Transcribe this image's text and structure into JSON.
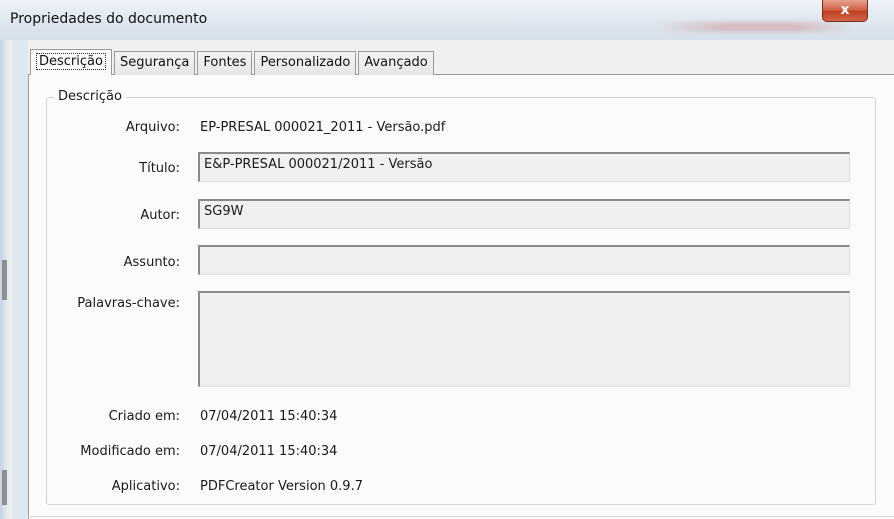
{
  "window": {
    "title": "Propriedades do documento",
    "close_symbol": "x"
  },
  "tabs": [
    {
      "label": "Descrição",
      "active": true
    },
    {
      "label": "Segurança"
    },
    {
      "label": "Fontes"
    },
    {
      "label": "Personalizado"
    },
    {
      "label": "Avançado"
    }
  ],
  "group": {
    "title": "Descrição"
  },
  "fields": {
    "arquivo": {
      "label": "Arquivo:",
      "value": "EP-PRESAL 000021_2011 - Versão.pdf"
    },
    "titulo": {
      "label": "Título:",
      "value": "E&P-PRESAL 000021/2011 - Versão"
    },
    "autor": {
      "label": "Autor:",
      "value": "SG9W"
    },
    "assunto": {
      "label": "Assunto:",
      "value": ""
    },
    "palavras": {
      "label": "Palavras-chave:",
      "value": ""
    },
    "criado": {
      "label": "Criado em:",
      "value": "07/04/2011 15:40:34"
    },
    "modificado": {
      "label": "Modificado em:",
      "value": "07/04/2011 15:40:34"
    },
    "aplicativo": {
      "label": "Aplicativo:",
      "value": "PDFCreator Version 0.9.7"
    }
  }
}
